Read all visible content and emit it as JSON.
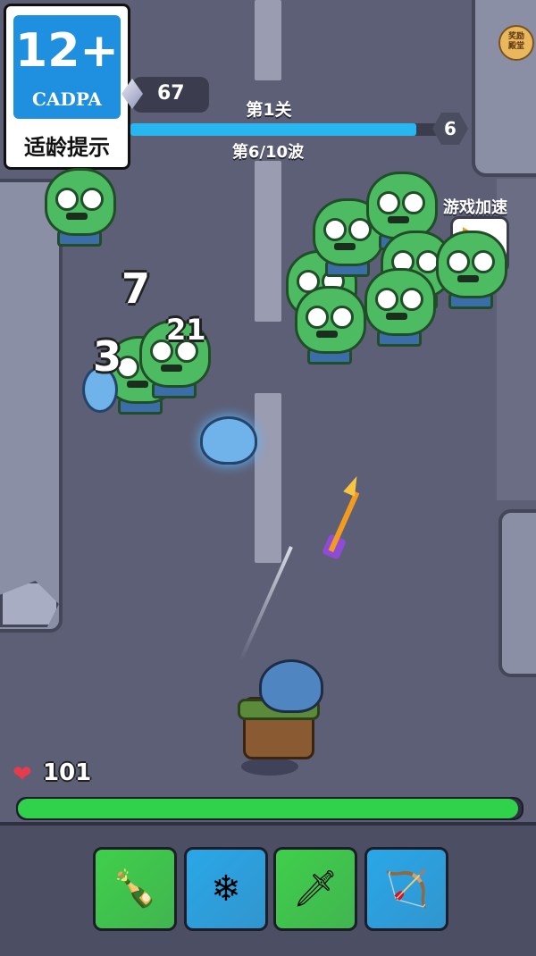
{
  "rating": {
    "age": "12+",
    "org": "CADPA",
    "tip": "适龄提示"
  },
  "hud": {
    "gems": "67",
    "level": "第1关",
    "wave": "第6/10波",
    "wave_badge": "6",
    "progress": 0.92,
    "corner_button": "奖励\n殿堂"
  },
  "speed": {
    "label": "游戏加速",
    "multiplier": "x1"
  },
  "damage_numbers": [
    "7",
    "21",
    "3"
  ],
  "player": {
    "hp": "101",
    "hp_fraction": 1.0
  },
  "skills": [
    {
      "name": "molotov",
      "icon": "molotov-icon",
      "color": "#3fcf4b"
    },
    {
      "name": "freeze-gun",
      "icon": "freeze-gun-icon",
      "color": "#2aa7e8"
    },
    {
      "name": "kunai",
      "icon": "kunai-icon",
      "color": "#3fcf4b"
    },
    {
      "name": "bow",
      "icon": "bow-icon",
      "color": "#2aa7e8"
    }
  ],
  "colors": {
    "hp_fill": "#2fd24a",
    "wave_bar": "#27b6ef",
    "zombie": "#4dbb62"
  }
}
